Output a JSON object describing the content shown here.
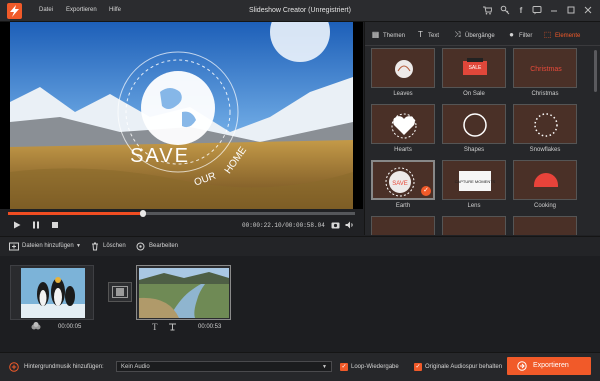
{
  "window": {
    "title": "Slideshow Creator (Unregistriert)"
  },
  "menu": [
    "Datei",
    "Exportieren",
    "Hilfe"
  ],
  "preview": {
    "overlay": {
      "main": "SAVE",
      "left": "OUR",
      "right": "HOME"
    }
  },
  "player": {
    "time": "00:00:22.10/00:00:58.04",
    "progress": 0.39
  },
  "tabs": [
    {
      "label": "Themen",
      "icon": "grid-icon"
    },
    {
      "label": "Text",
      "icon": "text-icon"
    },
    {
      "label": "Übergänge",
      "icon": "transition-icon"
    },
    {
      "label": "Filter",
      "icon": "filter-icon"
    },
    {
      "label": "Elemente",
      "icon": "elements-icon",
      "active": true
    }
  ],
  "elements": [
    {
      "label": "Leaves"
    },
    {
      "label": "On Sale",
      "thumb": "SALE"
    },
    {
      "label": "Christmas",
      "thumb": "Christmas"
    },
    {
      "label": "Hearts"
    },
    {
      "label": "Shapes"
    },
    {
      "label": "Snowflakes"
    },
    {
      "label": "Earth",
      "thumb": "SAVE"
    },
    {
      "label": "Lens",
      "thumb": "CAPTURE MOMENTS"
    },
    {
      "label": "Cooking"
    },
    {
      "label": ""
    },
    {
      "label": ""
    },
    {
      "label": ""
    }
  ],
  "toolbar": {
    "add": "Dateien hinzufügen",
    "delete": "Löschen",
    "edit": "Bearbeiten"
  },
  "timeline": {
    "clips": [
      {
        "duration": "00:00:05"
      },
      {
        "duration": "00:00:53"
      }
    ]
  },
  "bottom": {
    "music_label": "Hintergrundmusik hinzufügen:",
    "audio": "Kein Audio",
    "loop": "Loop-Wiedergabe",
    "keep": "Originale Audiospur behalten",
    "export": "Exportieren"
  },
  "colors": {
    "accent": "#f15a29"
  }
}
